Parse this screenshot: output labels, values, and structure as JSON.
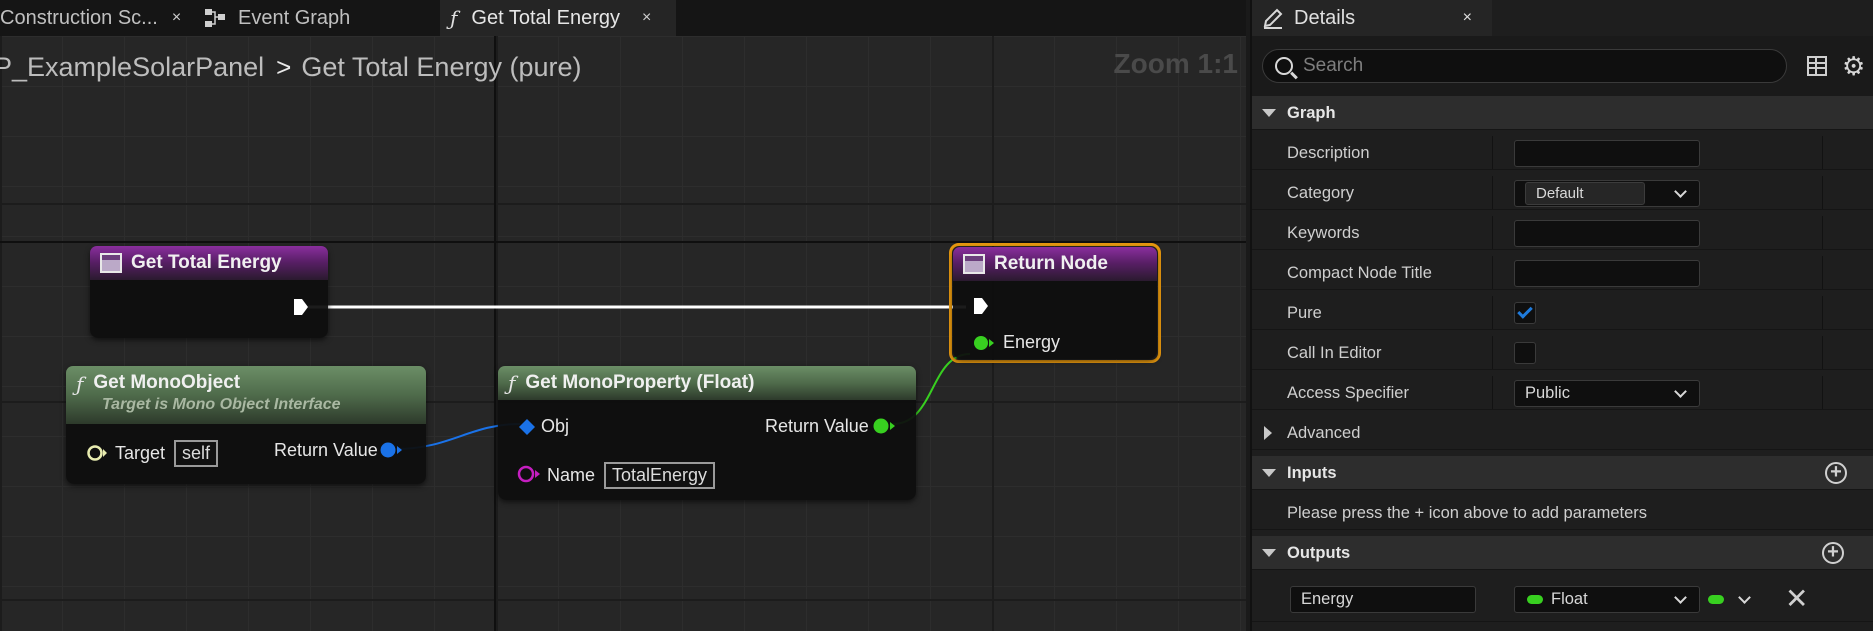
{
  "tabs": {
    "construction": {
      "label": "Construction Sc...",
      "close": "×"
    },
    "event_graph": {
      "label": "Event Graph"
    },
    "get_total_energy": {
      "label": "Get Total Energy",
      "close": "×"
    }
  },
  "breadcrumb": {
    "blueprint": "P_ExampleSolarPanel",
    "separator": ">",
    "function": "Get Total Energy (pure)"
  },
  "zoom_label": "Zoom 1:1",
  "nodes": {
    "entry": {
      "title": "Get Total Energy"
    },
    "return": {
      "title": "Return Node",
      "pin_energy": "Energy"
    },
    "mono_object": {
      "title": "Get MonoObject",
      "subtitle": "Target is Mono Object Interface",
      "pin_target": "Target",
      "target_value": "self",
      "pin_return": "Return Value"
    },
    "mono_property": {
      "title": "Get MonoProperty (Float)",
      "pin_obj": "Obj",
      "pin_return": "Return Value",
      "pin_name": "Name",
      "name_value": "TotalEnergy"
    }
  },
  "details": {
    "tab_label": "Details",
    "close": "×",
    "search_placeholder": "Search",
    "sections": {
      "graph": "Graph",
      "inputs": "Inputs",
      "outputs": "Outputs"
    },
    "fields": {
      "description": "Description",
      "category": "Category",
      "category_value": "Default",
      "keywords": "Keywords",
      "compact_node_title": "Compact Node Title",
      "pure": "Pure",
      "pure_checked": true,
      "call_in_editor": "Call In Editor",
      "access_specifier": "Access Specifier",
      "access_value": "Public",
      "advanced": "Advanced"
    },
    "inputs_hint": "Please press the + icon above to add parameters",
    "outputs": {
      "param_name": "Energy",
      "param_type": "Float"
    }
  },
  "colors": {
    "exec_wire": "#ffffff",
    "float_pin": "#38d020",
    "object_pin": "#1a72e8",
    "name_pin": "#c51ec0",
    "selection": "#e8990f"
  }
}
